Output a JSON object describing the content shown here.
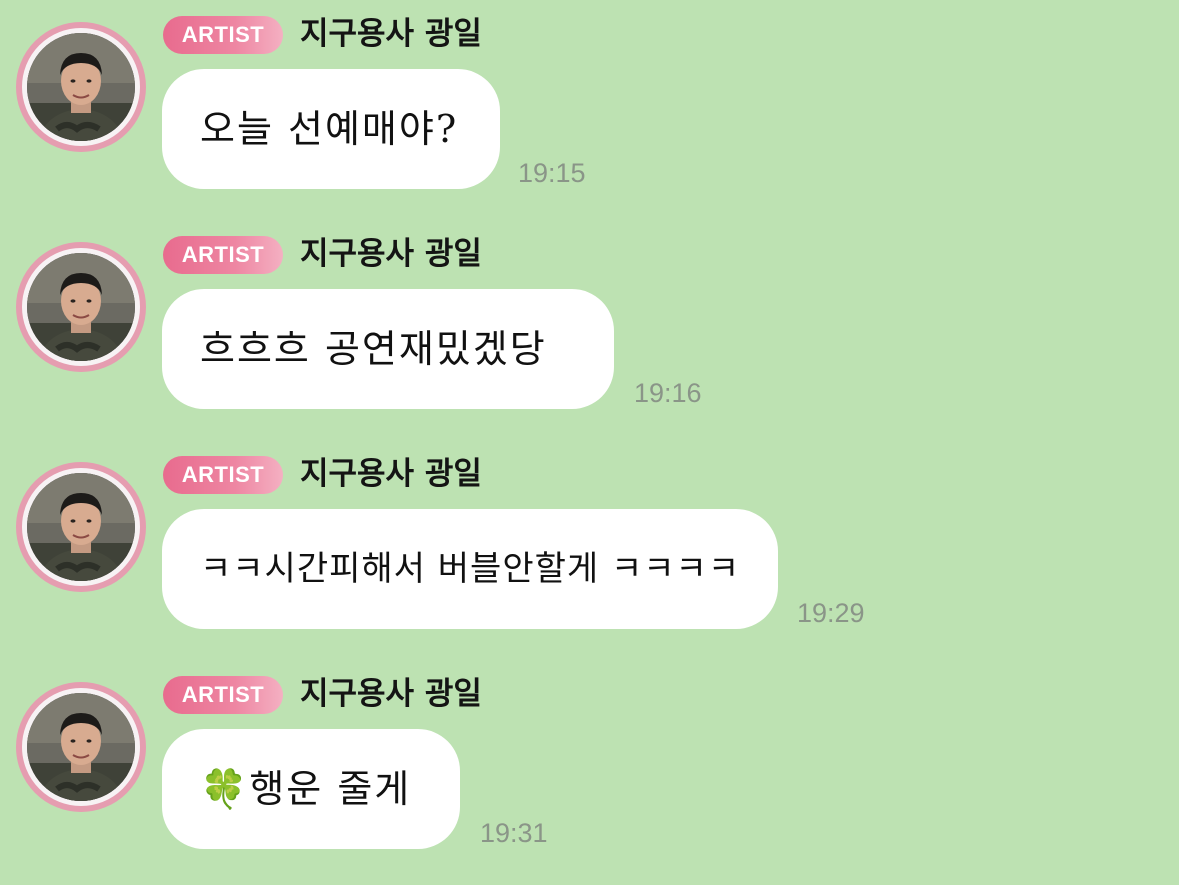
{
  "messages": [
    {
      "badge": "ARTIST",
      "sender": "지구용사 광일",
      "text": "오늘 선예매야?",
      "time": "19:15"
    },
    {
      "badge": "ARTIST",
      "sender": "지구용사 광일",
      "text": "흐흐흐 공연재밌겠당",
      "time": "19:16"
    },
    {
      "badge": "ARTIST",
      "sender": "지구용사 광일",
      "text": "ㅋㅋ시간피해서 버블안할게 ㅋㅋㅋㅋ",
      "time": "19:29"
    },
    {
      "badge": "ARTIST",
      "sender": "지구용사 광일",
      "text": "🍀행운 줄게",
      "time": "19:31"
    }
  ],
  "colors": {
    "background": "#bde2b2",
    "badge_pink": "#e86b8e",
    "avatar_ring": "#e59db0",
    "bubble": "#ffffff",
    "timestamp": "#8a9588"
  },
  "icons": {
    "avatar": "profile-photo"
  }
}
